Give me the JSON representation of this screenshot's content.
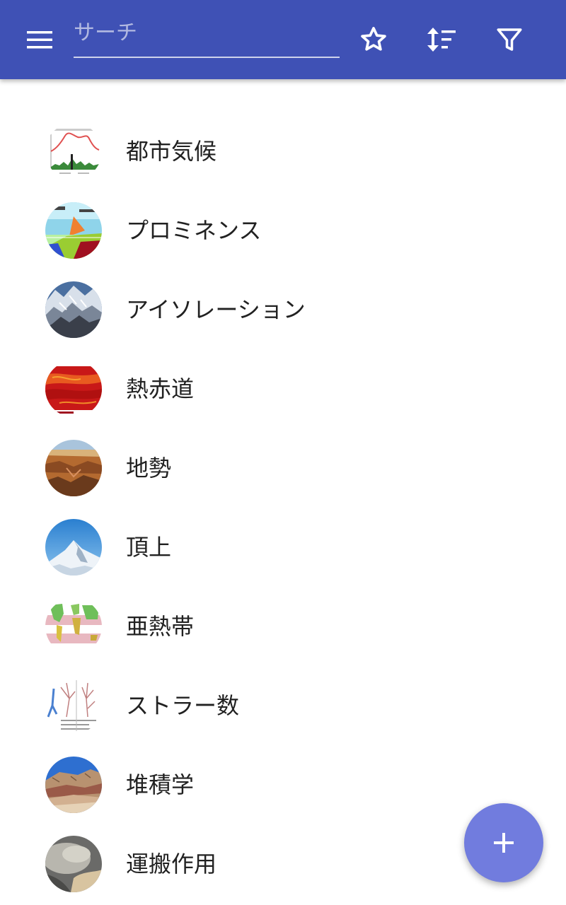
{
  "toolbar": {
    "menu_icon": "menu-icon",
    "search_placeholder": "サーチ",
    "search_value": "",
    "star_icon": "star-outline-icon",
    "sort_icon": "sort-icon",
    "filter_icon": "filter-icon",
    "background_color": "#3f51b5"
  },
  "list": {
    "items": [
      {
        "label": "都市気候",
        "thumbnail": "urban-heat-island-chart"
      },
      {
        "label": "プロミネンス",
        "thumbnail": "prominence-diagram"
      },
      {
        "label": "アイソレーション",
        "thumbnail": "mountain-snow-photo"
      },
      {
        "label": "熱赤道",
        "thumbnail": "temperature-map"
      },
      {
        "label": "地勢",
        "thumbnail": "canyon-photo"
      },
      {
        "label": "頂上",
        "thumbnail": "snow-peak-photo"
      },
      {
        "label": "亜熱帯",
        "thumbnail": "world-map-subtropics"
      },
      {
        "label": "ストラー数",
        "thumbnail": "stream-order-diagram"
      },
      {
        "label": "堆積学",
        "thumbnail": "sediment-cliff-photo"
      },
      {
        "label": "運搬作用",
        "thumbnail": "satellite-dust-photo"
      }
    ]
  },
  "fab": {
    "icon": "plus-icon",
    "color": "#717cde"
  }
}
